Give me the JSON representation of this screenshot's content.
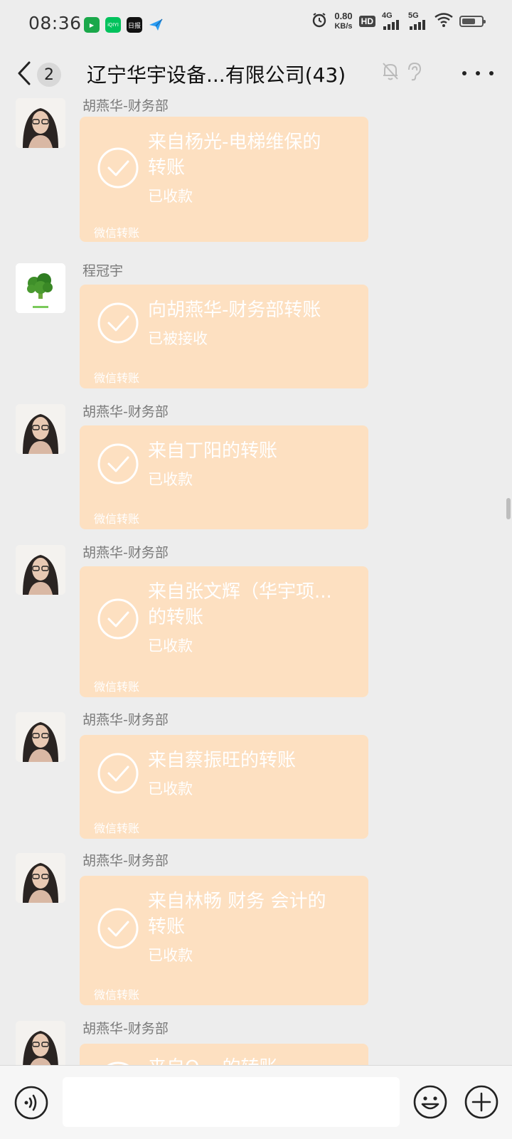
{
  "status_bar": {
    "time": "08:36",
    "net_speed_value": "0.80",
    "net_speed_unit": "KB/s",
    "hd": "HD",
    "sim1": "4G",
    "sim2": "5G",
    "app_icons": [
      "video-app-icon",
      "iqiyi-app-icon",
      "news-app-icon",
      "plane-app-icon"
    ],
    "app_icon_labels": [
      "",
      "iQIYI",
      "日报",
      ""
    ]
  },
  "header": {
    "unread_count": "2",
    "title": "辽宁华宇设备...有限公司(43)",
    "icons": [
      "mute-bell-icon",
      "ear-icon",
      "more-icon"
    ]
  },
  "messages": [
    {
      "sender": "胡燕华-财务部",
      "avatar": "woman-glasses-avatar",
      "title_lines": [
        "来自杨光-电梯维保的",
        "转账"
      ],
      "status": "已收款",
      "footer": "微信转账"
    },
    {
      "sender": "程冠宇",
      "avatar": "broccoli-avatar",
      "title_lines": [
        "向胡燕华-财务部转账"
      ],
      "status": "已被接收",
      "footer": "微信转账"
    },
    {
      "sender": "胡燕华-财务部",
      "avatar": "woman-glasses-avatar",
      "title_lines": [
        "来自丁阳的转账"
      ],
      "status": "已收款",
      "footer": "微信转账"
    },
    {
      "sender": "胡燕华-财务部",
      "avatar": "woman-glasses-avatar",
      "title_lines": [
        "来自张文辉（华宇项...",
        "的转账"
      ],
      "status": "已收款",
      "footer": "微信转账"
    },
    {
      "sender": "胡燕华-财务部",
      "avatar": "woman-glasses-avatar",
      "title_lines": [
        "来自蔡振旺的转账"
      ],
      "status": "已收款",
      "footer": "微信转账"
    },
    {
      "sender": "胡燕华-财务部",
      "avatar": "woman-glasses-avatar",
      "title_lines": [
        "来自林畅 财务 会计的",
        "转账"
      ],
      "status": "已收款",
      "footer": "微信转账"
    },
    {
      "sender": "胡燕华-财务部",
      "avatar": "woman-glasses-avatar",
      "title_lines": [
        "来自O... 的转账"
      ],
      "status": "",
      "footer": ""
    }
  ],
  "input_bar": {
    "placeholder": "",
    "icons": [
      "voice-icon",
      "emoji-icon",
      "plus-icon"
    ]
  },
  "colors": {
    "background": "#ededed",
    "transfer_card": "#fde0c1",
    "card_text": "#ffffff",
    "sender_text": "#7a7a7a"
  }
}
